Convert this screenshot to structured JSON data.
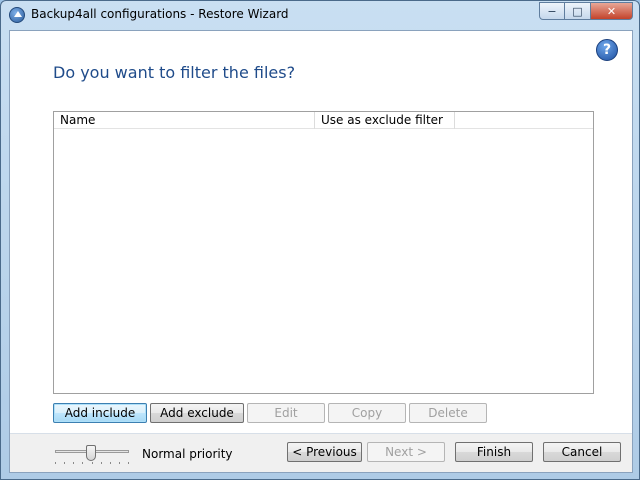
{
  "window": {
    "title": "Backup4all configurations - Restore Wizard",
    "controls": {
      "minimize": "−",
      "maximize": "□",
      "close": "✕"
    }
  },
  "page": {
    "heading": "Do you want to filter the files?",
    "help_symbol": "?"
  },
  "filter_list": {
    "columns": [
      "Name",
      "Use as exclude filter"
    ],
    "rows": []
  },
  "filter_buttons": {
    "add_include": "Add include",
    "add_exclude": "Add exclude",
    "edit": "Edit",
    "copy": "Copy",
    "delete": "Delete"
  },
  "footer": {
    "priority_label": "Normal priority",
    "priority_level": "Normal",
    "previous": "< Previous",
    "next": "Next >",
    "finish": "Finish",
    "cancel": "Cancel"
  },
  "colors": {
    "heading": "#1f4b8a",
    "focus_accent": "#3c7fb1",
    "disabled_text": "#a0a0a0"
  }
}
